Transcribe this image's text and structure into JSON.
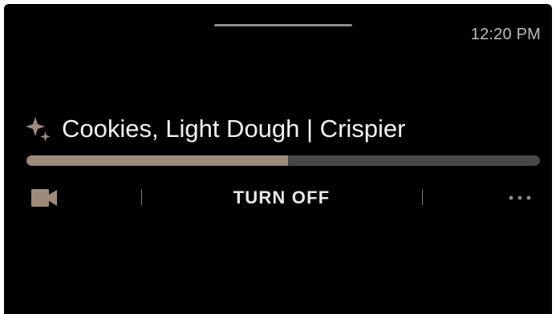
{
  "status_bar": {
    "time": "12:20 PM"
  },
  "cook": {
    "title": "Cookies, Light Dough | Crispier",
    "progress_fraction": 0.51
  },
  "controls": {
    "turn_off_label": "TURN OFF",
    "camera_icon": "video-camera-icon",
    "more_icon": "more-horizontal-icon"
  },
  "colors": {
    "background": "#000000",
    "accent": "#9c8a7c",
    "track": "#474747",
    "text": "#f2f2f2"
  }
}
